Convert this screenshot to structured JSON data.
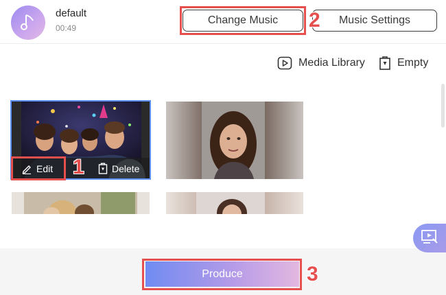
{
  "music": {
    "name": "default",
    "duration": "00:49",
    "icon": "music-note-icon"
  },
  "header": {
    "change_music_label": "Change Music",
    "music_settings_label": "Music Settings"
  },
  "toolbar": {
    "media_library_label": "Media Library",
    "media_library_icon": "play-square-icon",
    "empty_label": "Empty",
    "empty_icon": "trash-icon"
  },
  "media": {
    "items": [
      {
        "description": "party",
        "selected": true
      },
      {
        "description": "portrait-woman",
        "selected": false
      },
      {
        "description": "group-outdoor",
        "selected": false
      },
      {
        "description": "portrait-smile",
        "selected": false
      }
    ],
    "edit_label": "Edit",
    "edit_icon": "pencil-icon",
    "delete_label": "Delete",
    "delete_icon": "trash-icon"
  },
  "annotations": {
    "step1": "1",
    "step2": "2",
    "step3": "3",
    "color": "#e5504f"
  },
  "footer": {
    "produce_label": "Produce"
  },
  "colors": {
    "accent_blue": "#5b8def",
    "gradient_start": "#6f8cf2",
    "gradient_end": "#e3b8e0"
  }
}
